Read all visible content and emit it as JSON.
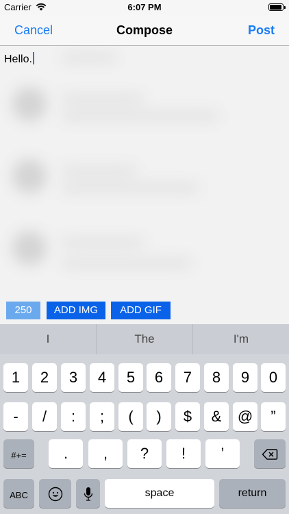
{
  "status_bar": {
    "carrier": "Carrier",
    "time": "6:07 PM"
  },
  "navbar": {
    "cancel_label": "Cancel",
    "title": "Compose",
    "post_label": "Post"
  },
  "compose": {
    "text": "Hello."
  },
  "actions": {
    "char_count": "250",
    "add_img_label": "ADD IMG",
    "add_gif_label": "ADD GIF"
  },
  "keyboard": {
    "suggestions": [
      "I",
      "The",
      "I'm"
    ],
    "row1": [
      "1",
      "2",
      "3",
      "4",
      "5",
      "6",
      "7",
      "8",
      "9",
      "0"
    ],
    "row2": [
      "-",
      "/",
      ":",
      ";",
      "(",
      ")",
      "$",
      "&",
      "@",
      "”"
    ],
    "row3": [
      ".",
      ",",
      "?",
      "!",
      "’"
    ],
    "symbols_label": "#+=",
    "abc_label": "ABC",
    "space_label": "space",
    "return_label": "return"
  }
}
